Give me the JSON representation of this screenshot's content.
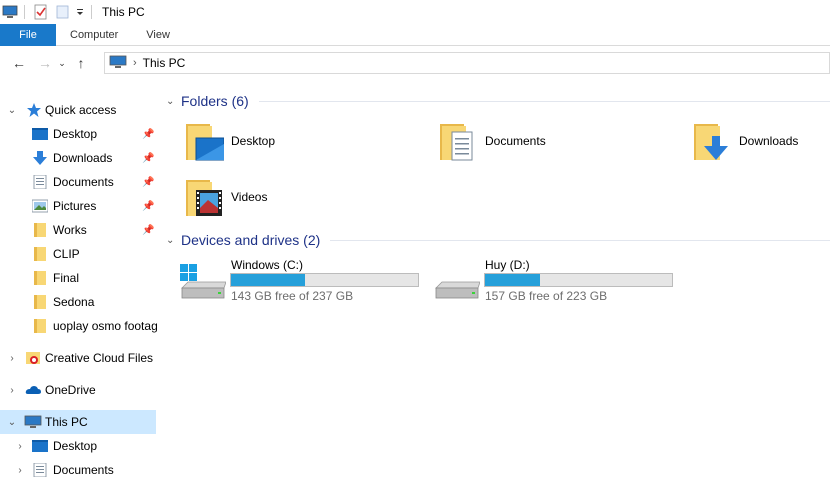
{
  "window": {
    "title": "This PC"
  },
  "ribbon": {
    "file": "File",
    "tabs": [
      "Computer",
      "View"
    ]
  },
  "address": {
    "segment": "This PC"
  },
  "sidebar": {
    "quick_access": "Quick access",
    "qa_items": [
      {
        "label": "Desktop",
        "icon": "desktop-icon",
        "pinned": true
      },
      {
        "label": "Downloads",
        "icon": "downloads-icon",
        "pinned": true
      },
      {
        "label": "Documents",
        "icon": "documents-icon",
        "pinned": true
      },
      {
        "label": "Pictures",
        "icon": "pictures-icon",
        "pinned": true
      },
      {
        "label": "Works",
        "icon": "folder-icon",
        "pinned": true
      },
      {
        "label": "CLIP",
        "icon": "folder-icon",
        "pinned": false
      },
      {
        "label": "Final",
        "icon": "folder-icon",
        "pinned": false
      },
      {
        "label": "Sedona",
        "icon": "folder-icon",
        "pinned": false
      },
      {
        "label": "uoplay osmo footag",
        "icon": "folder-icon",
        "pinned": false
      }
    ],
    "creative_cloud": "Creative Cloud Files",
    "onedrive": "OneDrive",
    "this_pc": "This PC",
    "pc_items": [
      "Desktop",
      "Documents"
    ]
  },
  "main": {
    "folders_header": "Folders (6)",
    "folders": [
      {
        "label": "Desktop",
        "icon": "desktop-folder-icon"
      },
      {
        "label": "Documents",
        "icon": "documents-folder-icon"
      },
      {
        "label": "Downloads",
        "icon": "downloads-folder-icon"
      },
      {
        "label": "Videos",
        "icon": "videos-folder-icon"
      }
    ],
    "drives_header": "Devices and drives (2)",
    "drives": [
      {
        "name": "Windows (C:)",
        "free": "143 GB free of 237 GB",
        "used_fraction": 0.397,
        "icon": "windows-drive-icon"
      },
      {
        "name": "Huy (D:)",
        "free": "157 GB free of 223 GB",
        "used_fraction": 0.296,
        "icon": "hard-drive-icon"
      }
    ]
  },
  "colors": {
    "accent": "#1979ca",
    "header": "#1e3287",
    "bar": "#26a0da",
    "selected": "#cce8ff",
    "folder": "#f8d775"
  }
}
